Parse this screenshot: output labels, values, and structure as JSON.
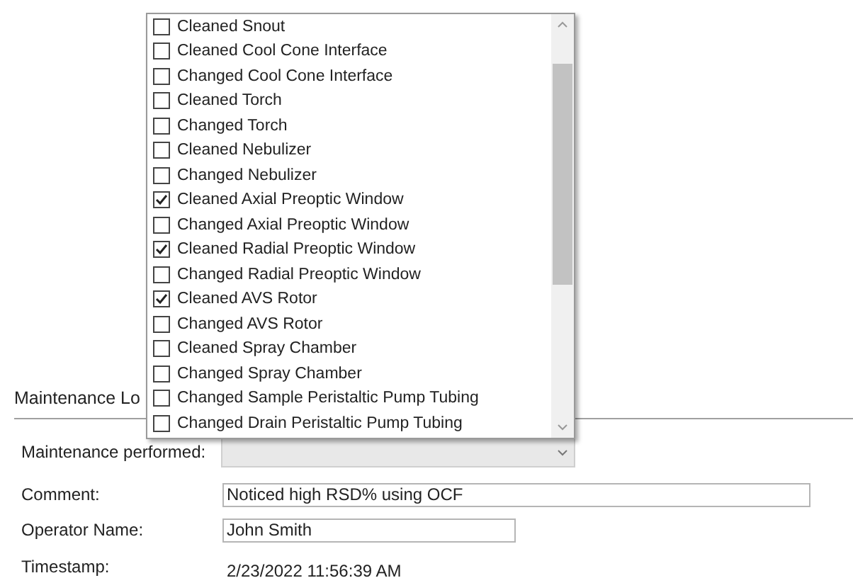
{
  "section": {
    "title": "Maintenance Lo"
  },
  "form": {
    "maintenance_label": "Maintenance performed:",
    "comment_label": "Comment:",
    "comment_value": "Noticed high RSD% using OCF",
    "operator_label": "Operator Name:",
    "operator_value": "John Smith",
    "timestamp_label": "Timestamp:",
    "timestamp_value": "2/23/2022 11:56:39 AM"
  },
  "dropdown_list": {
    "items": [
      {
        "label": "Cleaned Snout",
        "checked": false
      },
      {
        "label": "Cleaned Cool Cone Interface",
        "checked": false
      },
      {
        "label": "Changed Cool Cone Interface",
        "checked": false
      },
      {
        "label": "Cleaned Torch",
        "checked": false
      },
      {
        "label": "Changed Torch",
        "checked": false
      },
      {
        "label": "Cleaned Nebulizer",
        "checked": false
      },
      {
        "label": "Changed Nebulizer",
        "checked": false
      },
      {
        "label": "Cleaned Axial Preoptic Window",
        "checked": true
      },
      {
        "label": "Changed Axial Preoptic Window",
        "checked": false
      },
      {
        "label": "Cleaned Radial Preoptic Window",
        "checked": true
      },
      {
        "label": "Changed Radial Preoptic Window",
        "checked": false
      },
      {
        "label": "Cleaned AVS Rotor",
        "checked": true
      },
      {
        "label": "Changed AVS Rotor",
        "checked": false
      },
      {
        "label": "Cleaned Spray Chamber",
        "checked": false
      },
      {
        "label": "Changed Spray Chamber",
        "checked": false
      },
      {
        "label": "Changed Sample Peristaltic Pump Tubing",
        "checked": false
      },
      {
        "label": "Changed Drain Peristaltic Pump Tubing",
        "checked": false
      }
    ]
  }
}
